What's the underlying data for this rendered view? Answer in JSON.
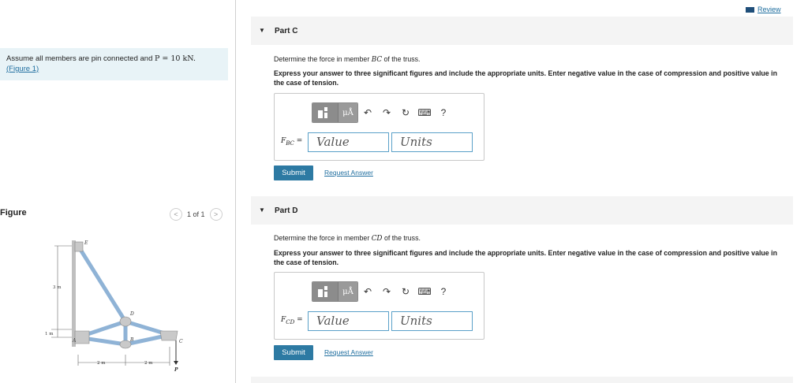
{
  "header": {
    "review_label": "Review"
  },
  "problem": {
    "assume_prefix": "Assume all members are pin connected and",
    "assume_eq": "P = 10 kN.",
    "figure_link": "(Figure 1)"
  },
  "figure": {
    "title": "Figure",
    "pager_text": "1 of 1",
    "labels": {
      "E": "E",
      "D": "D",
      "B": "B",
      "A": "A",
      "C": "C",
      "P": "P",
      "dim_3m": "3 m",
      "dim_1m": "1 m",
      "dim_2m_left": "2 m",
      "dim_2m_right": "2 m"
    }
  },
  "parts": [
    {
      "label": "Part C",
      "question_prefix": "Determine the force in member",
      "member": "BC",
      "question_suffix": "of the truss.",
      "instruction": "Express your answer to three significant figures and include the appropriate units. Enter negative value in the case of compression and positive value in the case of tension.",
      "field_label": "F",
      "field_sub": "BC",
      "value_placeholder": "Value",
      "units_placeholder": "Units",
      "submit_label": "Submit",
      "request_label": "Request Answer"
    },
    {
      "label": "Part D",
      "question_prefix": "Determine the force in member",
      "member": "CD",
      "question_suffix": "of the truss.",
      "instruction": "Express your answer to three significant figures and include the appropriate units. Enter negative value in the case of compression and positive value in the case of tension.",
      "field_label": "F",
      "field_sub": "CD",
      "value_placeholder": "Value",
      "units_placeholder": "Units",
      "submit_label": "Submit",
      "request_label": "Request Answer"
    }
  ],
  "toolbar": {
    "mu_label": "μÅ",
    "help_label": "?"
  }
}
